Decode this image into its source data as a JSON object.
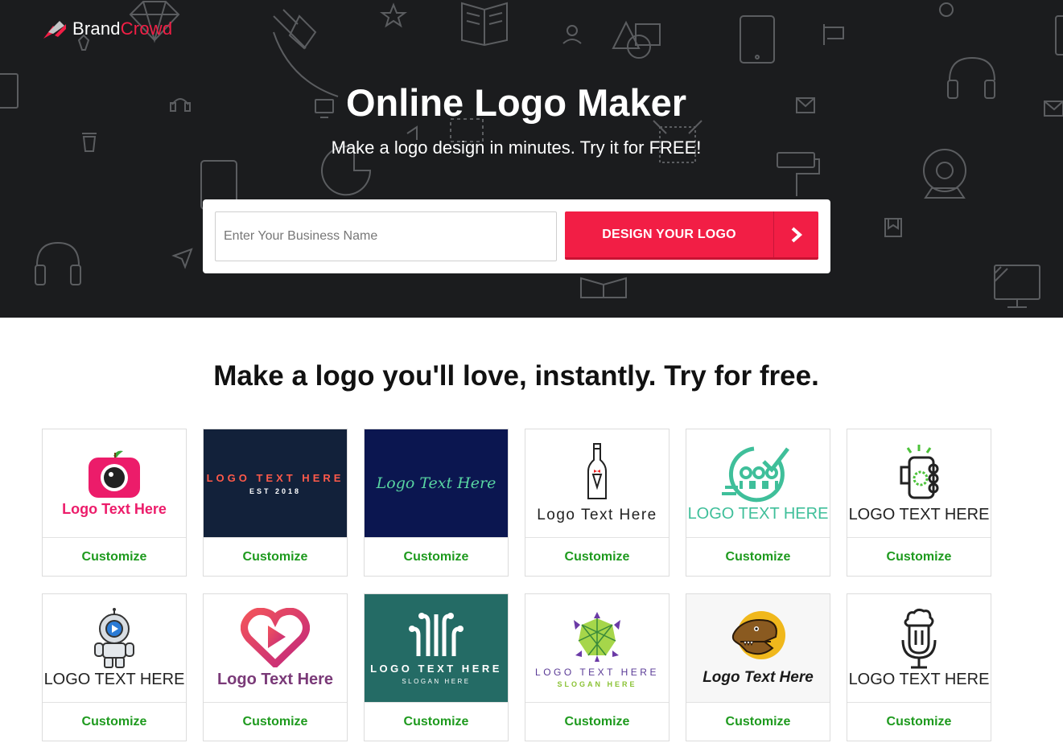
{
  "brand": {
    "name_part1": "Brand",
    "name_part2": "Crowd",
    "accent": "#f21e45"
  },
  "hero": {
    "title": "Online Logo Maker",
    "subtitle": "Make a logo design in minutes. Try it for FREE!",
    "input_placeholder": "Enter Your Business Name",
    "button_label": "DESIGN YOUR LOGO",
    "button_icon": "chevron-right-icon"
  },
  "section": {
    "title": "Make a logo you'll love, instantly. Try for free."
  },
  "cards": [
    {
      "text": "Logo Text Here",
      "icon": "camera-apple-icon",
      "cta": "Customize"
    },
    {
      "text": "LOGO TEXT HERE",
      "sub": "EST 2018",
      "cta": "Customize"
    },
    {
      "text": "Logo Text Here",
      "cta": "Customize"
    },
    {
      "text": "Logo Text Here",
      "icon": "wine-bottle-icon",
      "cta": "Customize"
    },
    {
      "text": "LOGO TEXT HERE",
      "icon": "team-check-icon",
      "cta": "Customize"
    },
    {
      "text": "LOGO TEXT HERE",
      "icon": "hand-gear-icon",
      "cta": "Customize"
    },
    {
      "text": "LOGO TEXT HERE",
      "icon": "astronaut-icon",
      "cta": "Customize"
    },
    {
      "text": "Logo Text Here",
      "icon": "heart-play-icon",
      "cta": "Customize"
    },
    {
      "text": "LOGO TEXT HERE",
      "sub": "SLOGAN HERE",
      "icon": "circuit-icon",
      "cta": "Customize"
    },
    {
      "text": "LOGO TEXT HERE",
      "sub": "SLOGAN HERE",
      "icon": "turtle-icon",
      "cta": "Customize"
    },
    {
      "text": "Logo Text Here",
      "icon": "dinosaur-icon",
      "cta": "Customize"
    },
    {
      "text": "LOGO TEXT HERE",
      "icon": "microphone-icon",
      "cta": "Customize"
    }
  ]
}
